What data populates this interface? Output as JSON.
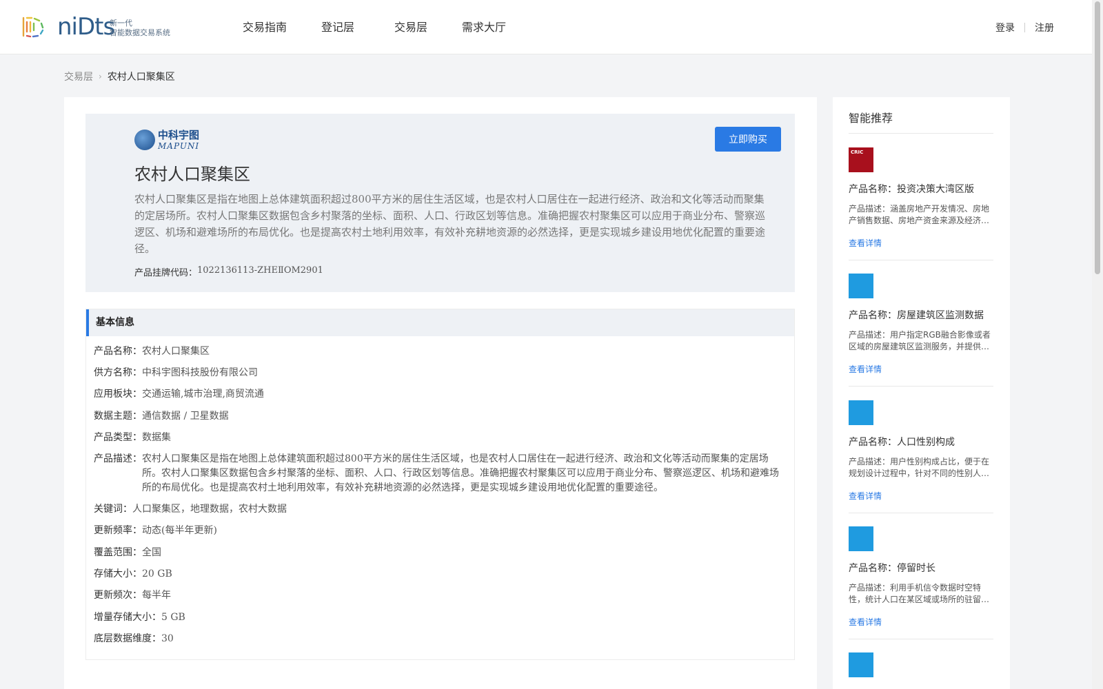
{
  "brand": {
    "logo_word": "niDts",
    "logo_sub_line1": "新一代",
    "logo_sub_line2": "智能数据交易系统"
  },
  "nav": {
    "items": [
      "交易指南",
      "登记层",
      "交易层",
      "需求大厅"
    ]
  },
  "auth": {
    "login": "登录",
    "register": "注册"
  },
  "breadcrumb": {
    "root": "交易层",
    "current": "农村人口聚集区"
  },
  "hero": {
    "vendor_logo_cn": "中科宇图",
    "vendor_logo_en": "MAPUNI",
    "buy_label": "立即购买",
    "title": "农村人口聚集区",
    "description": "农村人口聚集区是指在地图上总体建筑面积超过800平方米的居住生活区域，也是农村人口居住在一起进行经济、政治和文化等活动而聚集的定居场所。农村人口聚集区数据包含乡村聚落的坐标、面积、人口、行政区划等信息。准确把握农村聚集区可以应用于商业分布、警察巡逻区、机场和避难场所的布局优化。也是提高农村土地利用效率，有效补充耕地资源的必然选择，更是实现城乡建设用地优化配置的重要途径。",
    "code_label": "产品挂牌代码：",
    "code_value": "1022136113-ZHEⅡOM2901"
  },
  "info": {
    "heading": "基本信息",
    "rows": [
      {
        "label": "产品名称：",
        "value": "农村人口聚集区"
      },
      {
        "label": "供方名称：",
        "value": "中科宇图科技股份有限公司"
      },
      {
        "label": "应用板块：",
        "value": "交通运输,城市治理,商贸流通"
      },
      {
        "label": "数据主题：",
        "value": "通信数据 / 卫星数据"
      },
      {
        "label": "产品类型：",
        "value": "数据集"
      },
      {
        "label": "产品描述：",
        "value": "农村人口聚集区是指在地图上总体建筑面积超过800平方米的居住生活区域，也是农村人口居住在一起进行经济、政治和文化等活动而聚集的定居场所。农村人口聚集区数据包含乡村聚落的坐标、面积、人口、行政区划等信息。准确把握农村聚集区可以应用于商业分布、警察巡逻区、机场和避难场所的布局优化。也是提高农村土地利用效率，有效补充耕地资源的必然选择，更是实现城乡建设用地优化配置的重要途径。"
      },
      {
        "label": "关键词：",
        "value": "人口聚集区，地理数据，农村大数据"
      },
      {
        "label": "更新频率：",
        "value": "动态(每半年更新)"
      },
      {
        "label": "覆盖范围：",
        "value": "全国"
      },
      {
        "label": "存储大小：",
        "value": "20 GB"
      },
      {
        "label": "更新频次：",
        "value": "每半年"
      },
      {
        "label": "增量存储大小：",
        "value": "5 GB"
      },
      {
        "label": "底层数据维度：",
        "value": "30"
      }
    ]
  },
  "sidebar": {
    "title": "智能推荐",
    "items": [
      {
        "name": "产品名称：投资决策大湾区版",
        "desc": "产品描述：涵盖房地产开发情况、房地产销售数据、房地产资金来源及经济指标等数据",
        "link": "查看详情",
        "thumb_color": "#a8101d",
        "thumb_text": "CRIC"
      },
      {
        "name": "产品名称：房屋建筑区监测数据",
        "desc": "产品描述：用户指定RGB融合影像或者区域的房屋建筑区监测服务，并提供其变化数据",
        "link": "查看详情",
        "thumb_color": "#1f9be0",
        "thumb_text": ""
      },
      {
        "name": "产品名称：人口性别构成",
        "desc": "产品描述：用户性别构成占比，便于在规划设计过程中，针对不同的性别人群进行分析",
        "link": "查看详情",
        "thumb_color": "#1f9be0",
        "thumb_text": ""
      },
      {
        "name": "产品名称：停留时长",
        "desc": "产品描述：利用手机信令数据时空特性，统计人口在某区域或场所的驻留时长分布情况",
        "link": "查看详情",
        "thumb_color": "#1f9be0",
        "thumb_text": ""
      }
    ]
  }
}
